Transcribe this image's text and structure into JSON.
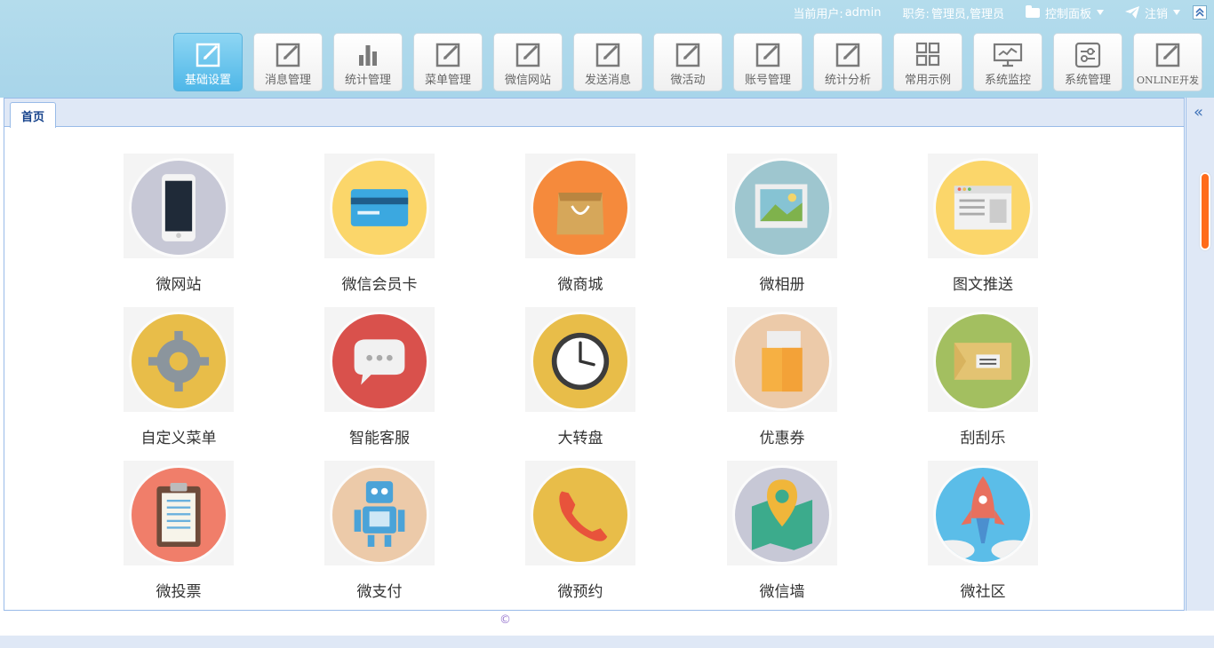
{
  "userbar": {
    "user_label": "当前用户:",
    "user_value": "admin",
    "role_label": "职务:",
    "role_value": "管理员,管理员",
    "control_panel": "控制面板",
    "logout": "注销"
  },
  "toolbar": {
    "items": [
      {
        "label": "基础设置",
        "icon": "edit-icon",
        "active": true
      },
      {
        "label": "消息管理",
        "icon": "edit-icon"
      },
      {
        "label": "统计管理",
        "icon": "bar-chart-icon"
      },
      {
        "label": "菜单管理",
        "icon": "edit-icon"
      },
      {
        "label": "微信网站",
        "icon": "edit-icon"
      },
      {
        "label": "发送消息",
        "icon": "edit-icon"
      },
      {
        "label": "微活动",
        "icon": "edit-icon"
      },
      {
        "label": "账号管理",
        "icon": "edit-icon"
      },
      {
        "label": "统计分析",
        "icon": "edit-icon"
      },
      {
        "label": "常用示例",
        "icon": "grid-icon"
      },
      {
        "label": "系统监控",
        "icon": "monitor-icon"
      },
      {
        "label": "系统管理",
        "icon": "settings-panel-icon"
      },
      {
        "label": "ONLINE开发",
        "icon": "edit-icon"
      }
    ]
  },
  "tabs": [
    {
      "label": "首页"
    }
  ],
  "apps": [
    {
      "label": "微网站",
      "icon": "phone-icon",
      "bg": "#c7c8d6"
    },
    {
      "label": "微信会员卡",
      "icon": "credit-card-icon",
      "bg": "#fbd66a"
    },
    {
      "label": "微商城",
      "icon": "shopping-bag-icon",
      "bg": "#f58a3c"
    },
    {
      "label": "微相册",
      "icon": "photo-icon",
      "bg": "#9ec6cf"
    },
    {
      "label": "图文推送",
      "icon": "browser-window-icon",
      "bg": "#fbd66a"
    },
    {
      "label": "自定义菜单",
      "icon": "gear-icon",
      "bg": "#e8bd49"
    },
    {
      "label": "智能客服",
      "icon": "chat-bubble-icon",
      "bg": "#d9514c"
    },
    {
      "label": "大转盘",
      "icon": "clock-icon",
      "bg": "#e8bd49"
    },
    {
      "label": "优惠券",
      "icon": "coupon-envelope-icon",
      "bg": "#eccaa9"
    },
    {
      "label": "刮刮乐",
      "icon": "ticket-icon",
      "bg": "#a3bf60"
    },
    {
      "label": "微投票",
      "icon": "clipboard-icon",
      "bg": "#f07e6a"
    },
    {
      "label": "微支付",
      "icon": "robot-icon",
      "bg": "#eccaa9"
    },
    {
      "label": "微预约",
      "icon": "phone-receiver-icon",
      "bg": "#e8bd49"
    },
    {
      "label": "微信墙",
      "icon": "map-pin-icon",
      "bg": "#c7c8d6"
    },
    {
      "label": "微社区",
      "icon": "rocket-icon",
      "bg": "#5bbde8"
    }
  ],
  "footer": {
    "copyright": "©"
  }
}
